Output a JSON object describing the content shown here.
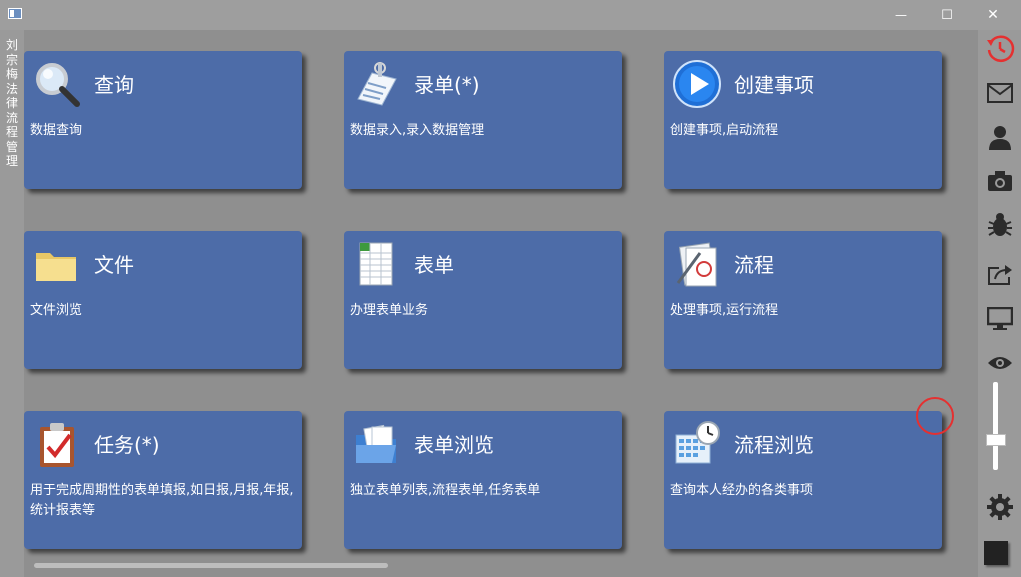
{
  "window": {
    "title": "刘宗梅法律流程管理",
    "minimize_glyph": "—",
    "maximize_glyph": "☐",
    "close_glyph": "✕"
  },
  "tiles": [
    {
      "icon": "magnifier-icon",
      "title": "查询",
      "desc": "数据查询"
    },
    {
      "icon": "document-entry-icon",
      "title": "录单(*)",
      "desc": "数据录入,录入数据管理"
    },
    {
      "icon": "play-icon",
      "title": "创建事项",
      "desc": "创建事项,启动流程"
    },
    {
      "icon": "folder-icon",
      "title": "文件",
      "desc": "文件浏览"
    },
    {
      "icon": "spreadsheet-icon",
      "title": "表单",
      "desc": "办理表单业务"
    },
    {
      "icon": "process-doc-icon",
      "title": "流程",
      "desc": "处理事项,运行流程"
    },
    {
      "icon": "clipboard-check-icon",
      "title": "任务(*)",
      "desc": "用于完成周期性的表单填报,如日报,月报,年报,统计报表等"
    },
    {
      "icon": "folder-files-icon",
      "title": "表单浏览",
      "desc": "独立表单列表,流程表单,任务表单"
    },
    {
      "icon": "calendar-clock-icon",
      "title": "流程浏览",
      "desc": "查询本人经办的各类事项"
    }
  ],
  "right_bar": {
    "icons": [
      "history-clock-icon",
      "mail-icon",
      "user-icon",
      "camera-icon",
      "bug-icon",
      "share-icon",
      "monitor-icon",
      "eye-icon",
      "gear-icon"
    ],
    "accent": "#e53030",
    "slider_level": 0.35
  }
}
